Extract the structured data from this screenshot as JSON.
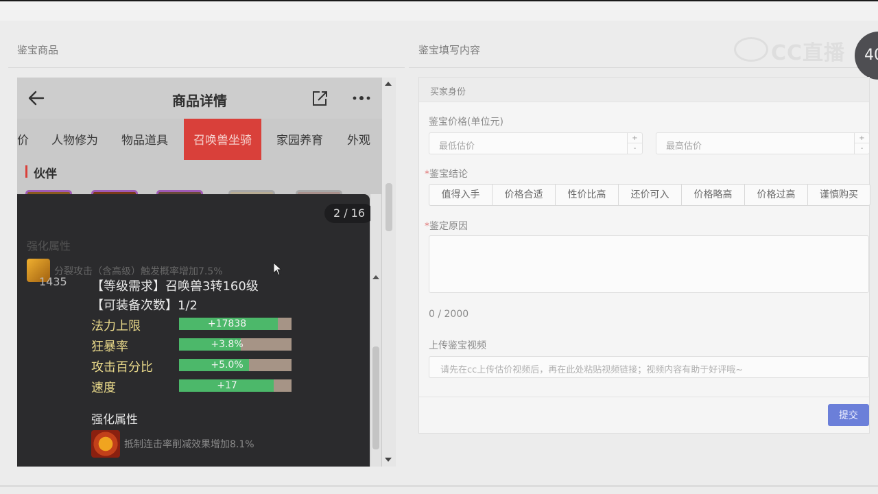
{
  "left_section": {
    "title": "鉴宝商品"
  },
  "right_section": {
    "title": "鉴宝填写内容"
  },
  "watermark": {
    "text": "CC直播"
  },
  "corner_badge": {
    "text": "40"
  },
  "phone": {
    "header": {
      "title": "商品详情"
    },
    "tabs": [
      "价",
      "人物修为",
      "物品道具",
      "召唤兽坐骑",
      "家园养育",
      "外观"
    ],
    "active_tab": "召唤兽坐骑",
    "partner_label": "伙伴",
    "popup": {
      "pager": "2 / 16",
      "faded_heading": "强化属性",
      "faded_effect": "分裂攻击（含高级）触发概率增加7.5%",
      "level_value": "1435",
      "requirement": "【等级需求】召唤兽3转160级",
      "equip_count": "【可装备次数】1/2",
      "attributes": [
        {
          "label": "法力上限",
          "value": "+17838",
          "fill": 0.88
        },
        {
          "label": "狂暴率",
          "value": "+3.8%",
          "fill": 0.55
        },
        {
          "label": "攻击百分比",
          "value": "+5.0%",
          "fill": 0.62
        },
        {
          "label": "速度",
          "value": "+17",
          "fill": 0.84
        }
      ],
      "enhance_title": "强化属性",
      "enhance_effect": "抵制连击率削减效果增加8.1%"
    }
  },
  "form": {
    "buyer_identity": "买家身份",
    "price_label": "鉴宝价格(单位元)",
    "min_placeholder": "最低估价",
    "max_placeholder": "最高估价",
    "conclusion_label": "鉴宝结论",
    "conclusion_options": [
      "值得入手",
      "价格合适",
      "性价比高",
      "还价可入",
      "价格略高",
      "价格过高",
      "谨慎购买"
    ],
    "reason_label": "鉴定原因",
    "counter": "0 / 2000",
    "video_label": "上传鉴宝视频",
    "video_placeholder": "请先在cc上传估价视频后，再在此处粘贴视频链接；视频内容有助于好评哦~",
    "submit_label": "提交"
  },
  "colors": {
    "active_tab_bg": "#d9403a",
    "bar_green": "#4cb86a",
    "bar_empty": "#a69486",
    "submit_bg": "#6b7fd9",
    "popup_bg": "#2b2b2d",
    "slot_border": "#a05ab5"
  },
  "icons": [
    "back-arrow-icon",
    "share-icon",
    "more-icon",
    "cursor-icon"
  ]
}
